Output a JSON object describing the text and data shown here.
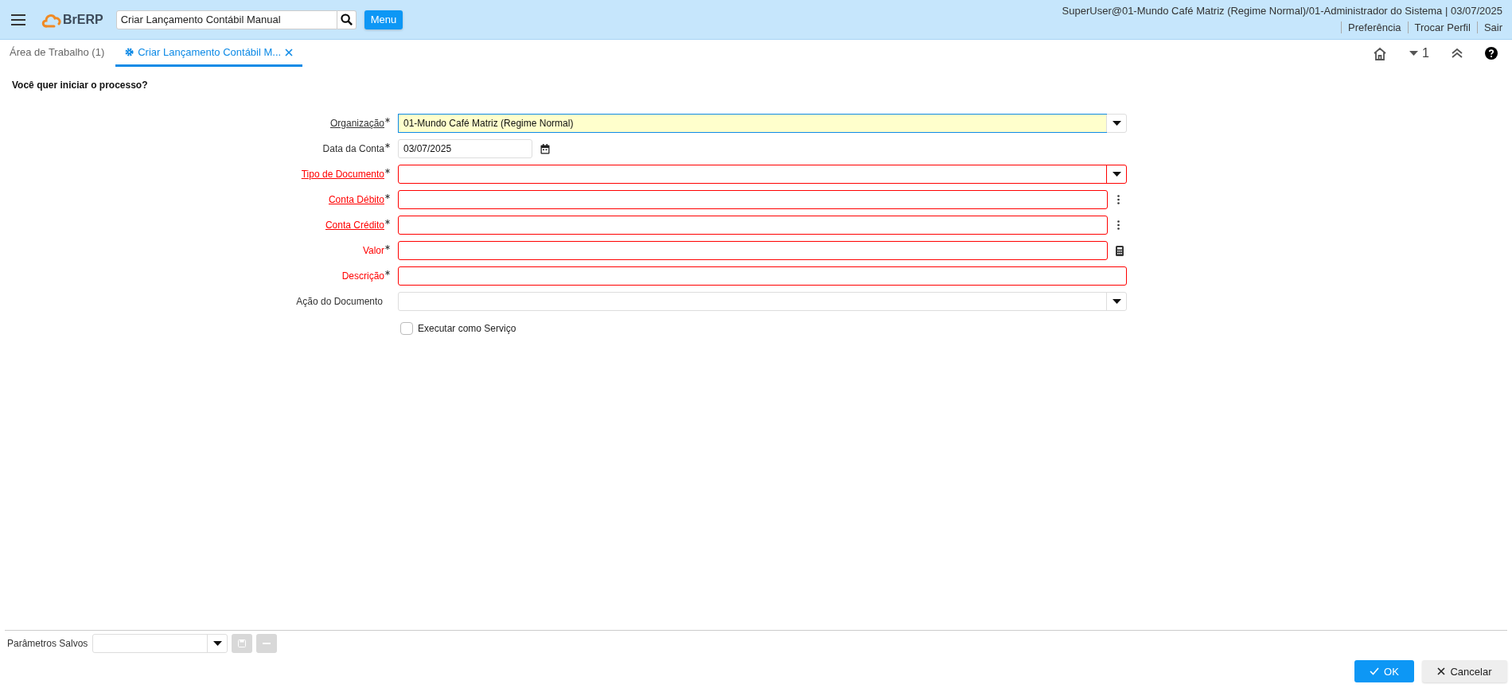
{
  "header": {
    "search_value": "Criar Lançamento Contábil Manual",
    "menu_button": "Menu",
    "logo_text": "BrERP",
    "user_info": "SuperUser@01-Mundo Café Matriz (Regime Normal)/01-Administrador do Sistema | 03/07/2025",
    "links": [
      "Preferência",
      "Trocar Perfil",
      "Sair"
    ]
  },
  "tabs": [
    {
      "label": "Área de Trabalho (1)",
      "selected": false,
      "closable": false
    },
    {
      "label": "Criar Lançamento Contábil M...",
      "selected": true,
      "closable": true
    }
  ],
  "toolbar": {
    "window_count": "1"
  },
  "prompt": "Você quer iniciar o processo?",
  "fields": [
    {
      "kind": "lookup",
      "label": "Organização",
      "required": true,
      "link": true,
      "error": false,
      "focused": true,
      "value": "01-Mundo Café Matriz (Regime Normal)"
    },
    {
      "kind": "date",
      "label": "Data da Conta",
      "required": true,
      "link": false,
      "error": false,
      "focused": false,
      "value": "03/07/2025"
    },
    {
      "kind": "lookup",
      "label": "Tipo de Documento",
      "required": true,
      "link": true,
      "error": true,
      "focused": false
    },
    {
      "kind": "search",
      "label": "Conta Débito",
      "required": true,
      "link": true,
      "error": true,
      "focused": false
    },
    {
      "kind": "search",
      "label": "Conta Crédito",
      "required": true,
      "link": true,
      "error": true,
      "focused": false
    },
    {
      "kind": "number",
      "label": "Valor",
      "required": true,
      "link": false,
      "error": true,
      "focused": false
    },
    {
      "kind": "text",
      "label": "Descrição",
      "required": true,
      "link": false,
      "error": true,
      "focused": false
    },
    {
      "kind": "lookup",
      "label": "Ação do Documento",
      "link": false,
      "error": false,
      "focused": false
    }
  ],
  "run_as_service": {
    "label": "Executar como Serviço",
    "checked": false
  },
  "footer": {
    "saved_params_label": "Parâmetros Salvos",
    "ok": "OK",
    "cancel": "Cancelar"
  }
}
